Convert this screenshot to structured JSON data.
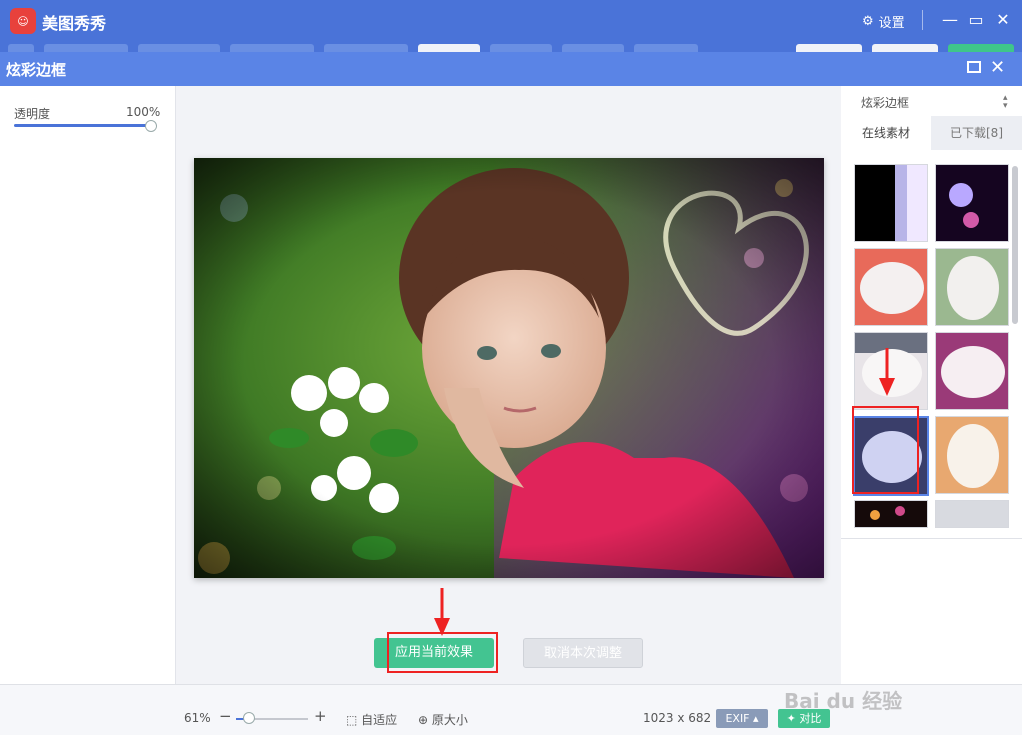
{
  "app": {
    "name": "美图秀秀",
    "settings_label": "设置"
  },
  "dialog": {
    "title": "炫彩边框"
  },
  "left_panel": {
    "opacity_label": "透明度",
    "opacity_value": "100%",
    "opacity_level": 1.0
  },
  "canvas": {
    "apply_label": "应用当前效果",
    "cancel_label": "取消本次调整"
  },
  "right_panel": {
    "category": "炫彩边框",
    "tabs": [
      {
        "label": "在线素材",
        "active": true
      },
      {
        "label": "已下载[8]",
        "active": false
      }
    ]
  },
  "bottom_bar": {
    "zoom": "61%",
    "zoom_minus": "−",
    "zoom_plus": "+",
    "fit_label": "自适应",
    "original_label": "原大小",
    "dimensions": "1023 x 682",
    "exif_label": "EXIF ▴",
    "compare_label": "对比"
  },
  "watermark": {
    "text": "Bai du 经验"
  },
  "colors": {
    "titlebar": "#4a73d8",
    "dialog_header": "#5a84e6",
    "accent_green": "#43c491",
    "highlight_red": "#e22222"
  }
}
